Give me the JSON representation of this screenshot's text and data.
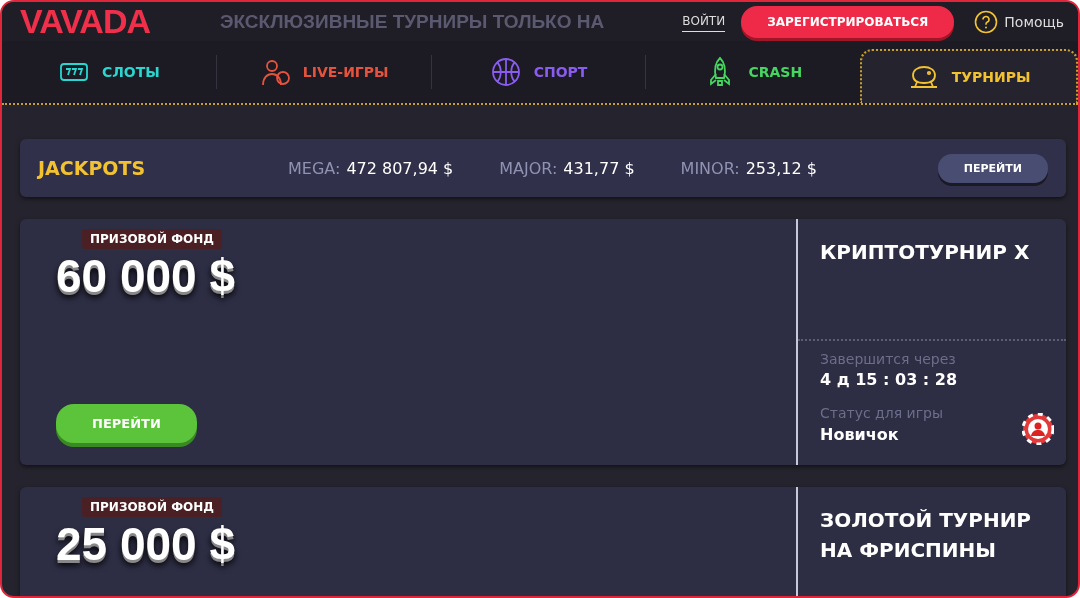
{
  "header": {
    "logo": "VAVADA",
    "banner": "ЭКСКЛЮЗИВНЫЕ ТУРНИРЫ ТОЛЬКО НА",
    "login": "ВОЙТИ",
    "register": "ЗАРЕГИСТРИРОВАТЬСЯ",
    "help": "Помощь"
  },
  "tabs": [
    {
      "label": "СЛОТЫ",
      "kind": "slots",
      "color": "#2ad6d0",
      "selected": false
    },
    {
      "label": "LIVE-ИГРЫ",
      "kind": "live",
      "color": "#e5533d",
      "selected": false
    },
    {
      "label": "СПОРТ",
      "kind": "sport",
      "color": "#8a5cf0",
      "selected": false
    },
    {
      "label": "CRASH",
      "kind": "crash",
      "color": "#45d660",
      "selected": false
    },
    {
      "label": "ТУРНИРЫ",
      "kind": "tournaments",
      "color": "#f2c230",
      "selected": true
    }
  ],
  "jackpots": {
    "title": "JACKPOTS",
    "items": [
      {
        "label": "MEGA:",
        "value": "472 807,94 $"
      },
      {
        "label": "MAJOR:",
        "value": "431,77 $"
      },
      {
        "label": "MINOR:",
        "value": "253,12 $"
      }
    ],
    "button": "ПЕРЕЙТИ"
  },
  "tournaments": [
    {
      "badge": "ПРИЗОВОЙ ФОНД",
      "amount": "60 000 $",
      "button": "ПЕРЕЙТИ",
      "title": "КРИПТОТУРНИР X",
      "ends_label": "Завершится через",
      "timer": "4 д 15 : 03 : 28",
      "status_label": "Статус для игры",
      "status": "Новичок"
    },
    {
      "badge": "ПРИЗОВОЙ ФОНД",
      "amount": "25 000 $",
      "title": "ЗОЛОТОЙ ТУРНИР НА ФРИСПИНЫ"
    }
  ]
}
